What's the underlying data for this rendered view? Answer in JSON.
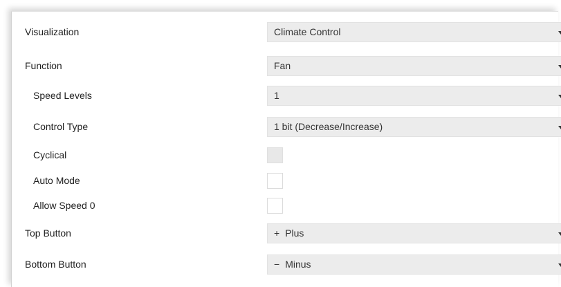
{
  "rows": {
    "visualization": {
      "label": "Visualization",
      "value": "Climate Control"
    },
    "function": {
      "label": "Function",
      "value": "Fan"
    },
    "speed_levels": {
      "label": "Speed Levels",
      "value": "1"
    },
    "control_type": {
      "label": "Control Type",
      "value": "1 bit (Decrease/Increase)"
    },
    "cyclical": {
      "label": "Cyclical",
      "checked": false,
      "disabled": true
    },
    "auto_mode": {
      "label": "Auto Mode",
      "checked": false,
      "disabled": false
    },
    "allow_speed_0": {
      "label": "Allow Speed 0",
      "checked": false,
      "disabled": false
    },
    "top_button": {
      "label": "Top Button",
      "glyph": "+",
      "value": "Plus"
    },
    "bottom_button": {
      "label": "Bottom Button",
      "glyph": "−",
      "value": "Minus"
    }
  },
  "icons": {
    "dropdown_caret": "chevron-down-icon"
  },
  "colors": {
    "dropdown_bg": "#ececec",
    "disabled_checkbox": "#e8e8e8",
    "text": "#1f1f1f"
  }
}
